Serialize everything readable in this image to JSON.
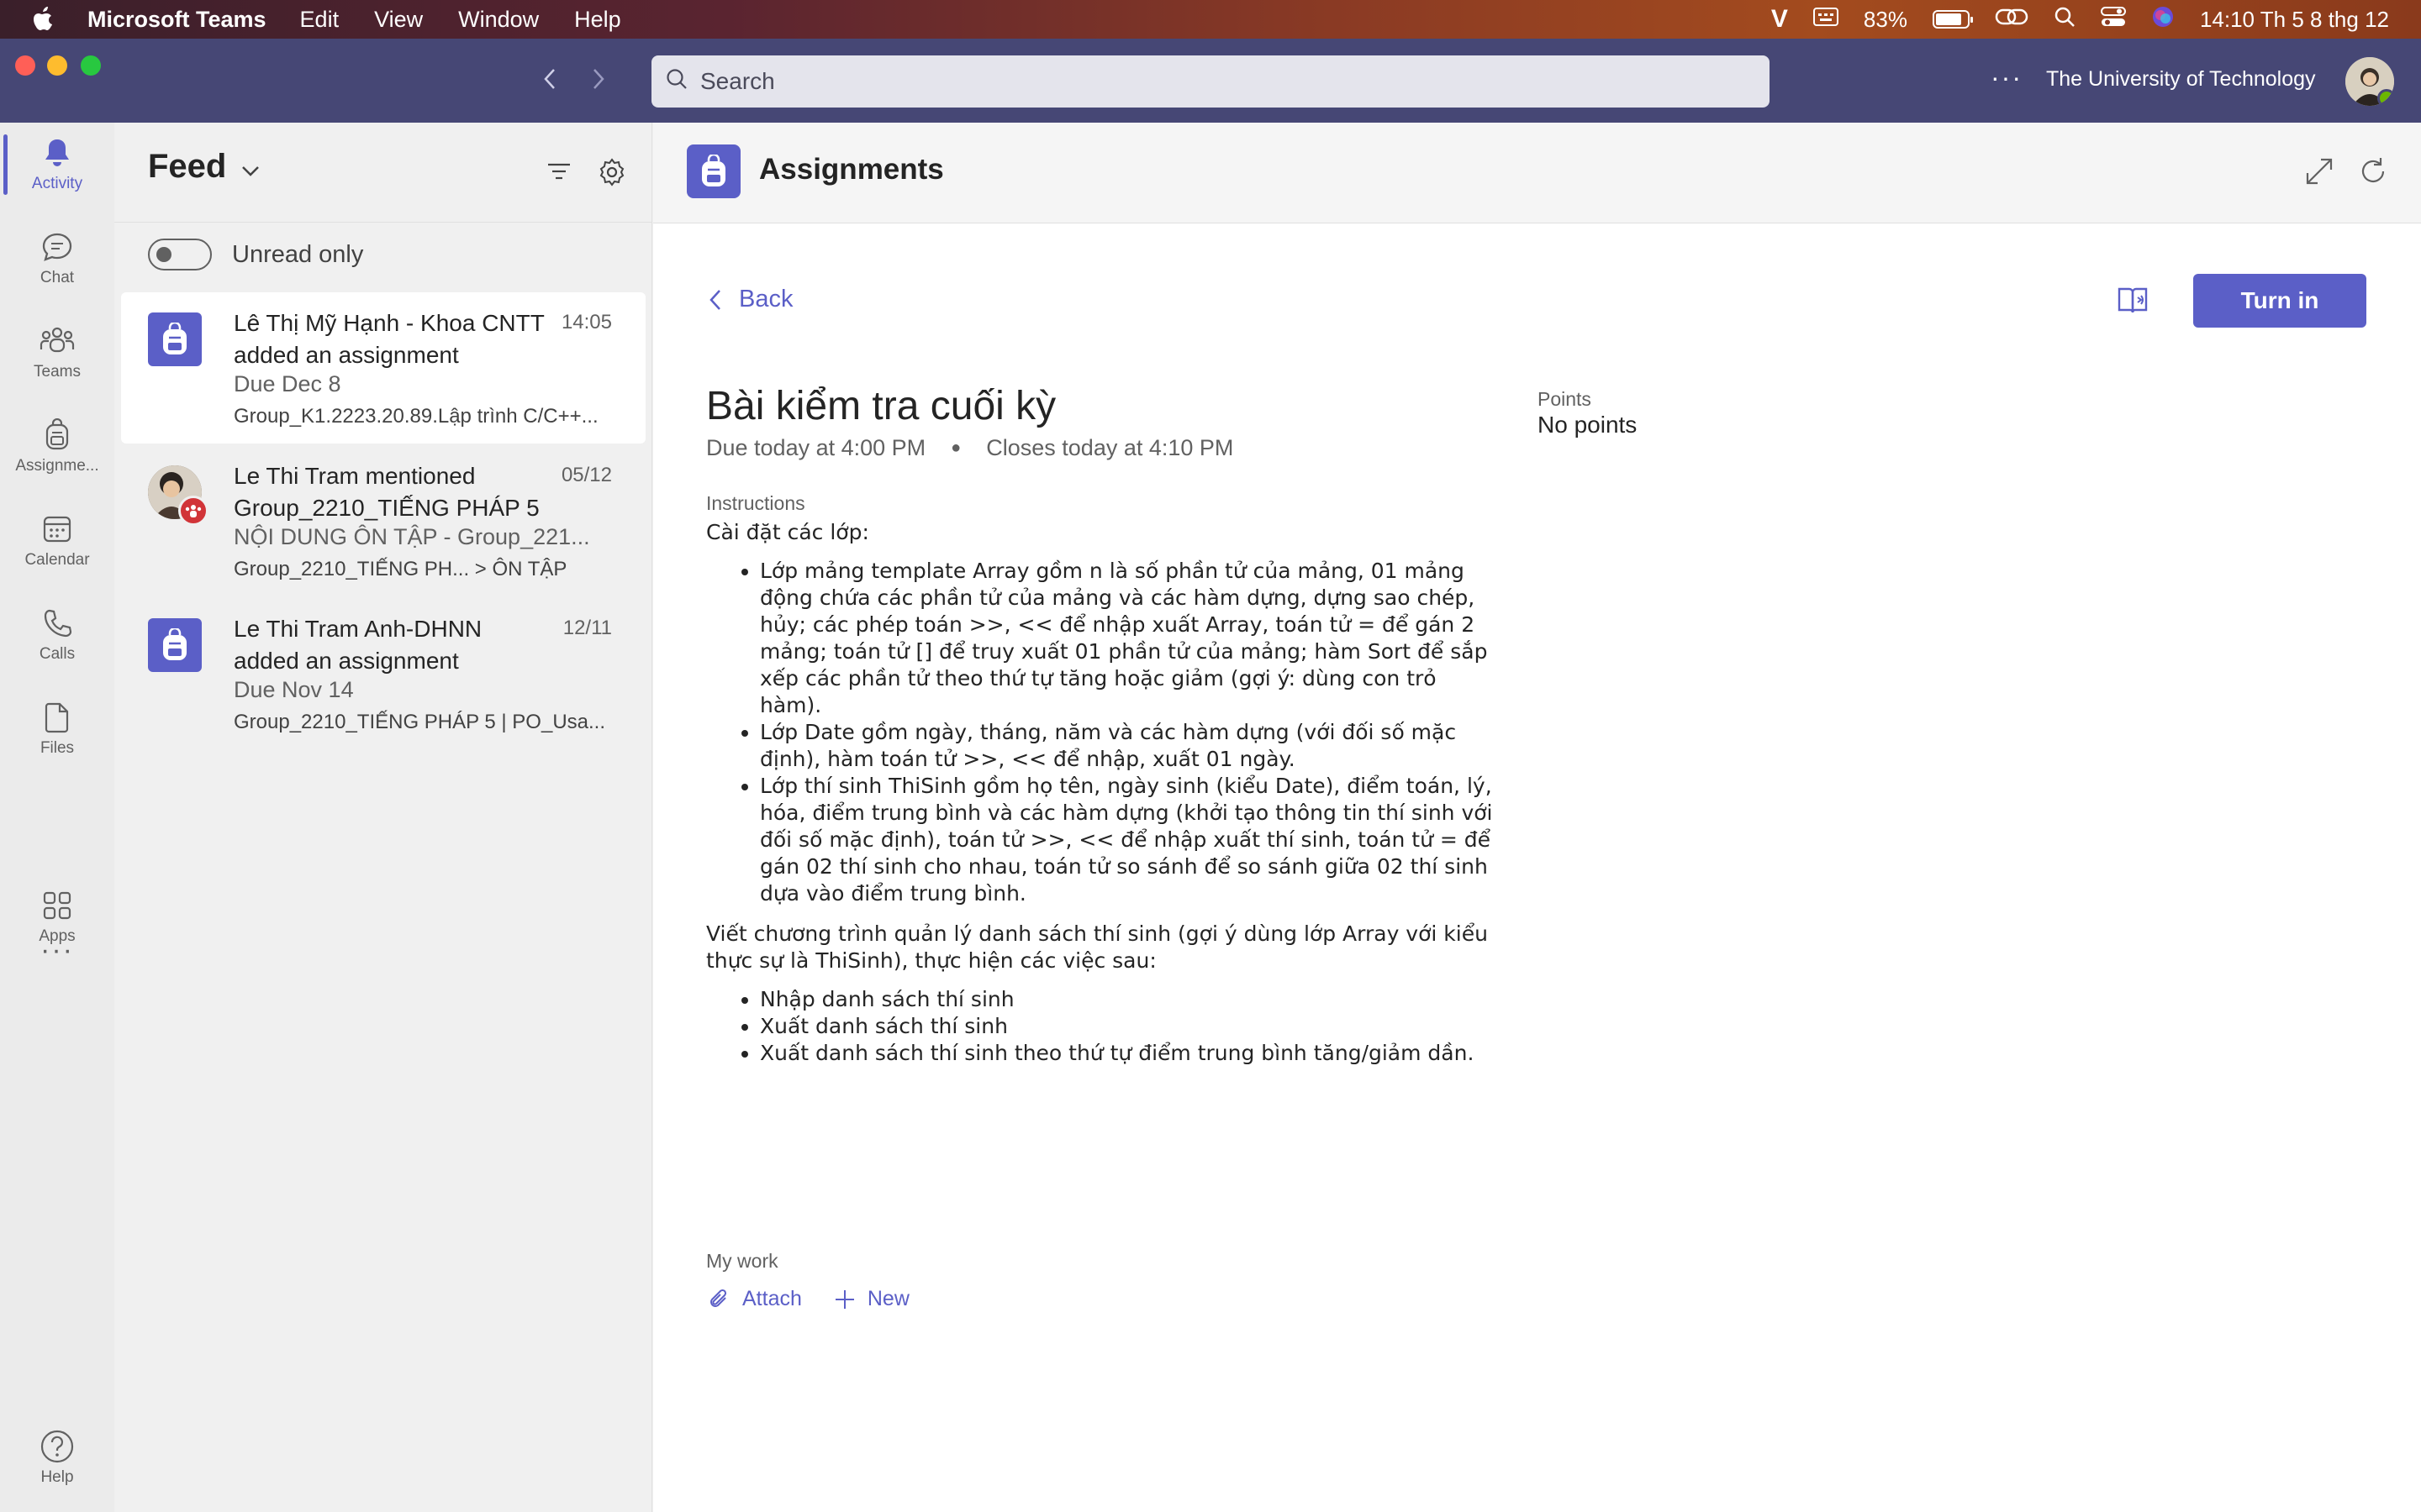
{
  "menubar": {
    "app_name": "Microsoft Teams",
    "menus": [
      "Edit",
      "View",
      "Window",
      "Help"
    ],
    "battery_percent": "83%",
    "battery_level": 0.83,
    "clock": "14:10 Th 5 8 thg 12"
  },
  "titlebar": {
    "search_placeholder": "Search",
    "more_label": "···",
    "org_name": "The University of Technology"
  },
  "rail": {
    "items": [
      {
        "label": "Activity",
        "icon": "bell-icon"
      },
      {
        "label": "Chat",
        "icon": "chat-icon"
      },
      {
        "label": "Teams",
        "icon": "teams-icon"
      },
      {
        "label": "Assignme...",
        "icon": "backpack-icon"
      },
      {
        "label": "Calendar",
        "icon": "calendar-icon"
      },
      {
        "label": "Calls",
        "icon": "phone-icon"
      },
      {
        "label": "Files",
        "icon": "file-icon"
      },
      {
        "label": "Apps",
        "icon": "apps-icon"
      }
    ],
    "more_label": "···",
    "help_label": "Help"
  },
  "feed": {
    "title": "Feed",
    "unread_only_label": "Unread only",
    "items": [
      {
        "line1": "Lê Thị Mỹ Hạnh - Khoa CNTT added an assignment",
        "time": "14:05",
        "line3": "Due Dec 8",
        "line4": "Group_K1.2223.20.89.Lập trình C/C++..."
      },
      {
        "line1": "Le Thi Tram mentioned Group_2210_TIẾNG PHÁP 5",
        "time": "05/12",
        "line3": "NỘI DUNG ÔN TẬP - Group_221...",
        "line4": "Group_2210_TIẾNG PH...   > ÔN TẬP"
      },
      {
        "line1": "Le Thi Tram Anh-DHNN added an assignment",
        "time": "12/11",
        "line3": "Due Nov 14",
        "line4": "Group_2210_TIẾNG PHÁP 5 | PO_Usa..."
      }
    ]
  },
  "main": {
    "title": "Assignments",
    "back_label": "Back",
    "turn_in_label": "Turn in",
    "assignment_title": "Bài kiểm tra cuối kỳ",
    "due": "Due today at 4:00 PM",
    "bullet": "●",
    "closes": "Closes today at 4:10 PM",
    "points_label": "Points",
    "points_value": "No points",
    "instructions_label": "Instructions",
    "instructions_intro": "Cài đặt các lớp:",
    "class_list": [
      "Lớp  mảng template Array gồm n là số phần tử của mảng, 01 mảng động chứa các phần tử của mảng và các hàm dựng, dựng sao chép, hủy; các phép toán >>, << để nhập xuất Array, toán tử = để gán 2 mảng; toán tử [] để truy xuất 01 phần tử của mảng; hàm Sort để sắp xếp các phần tử theo thứ tự tăng hoặc giảm (gợi ý: dùng con trỏ hàm).",
      "Lớp Date gồm ngày, tháng, năm và các hàm dựng (với đối số mặc định), hàm toán tử >>, << để nhập, xuất 01 ngày.",
      "Lớp thí sinh ThiSinh gồm họ tên, ngày sinh (kiểu Date), điểm toán, lý, hóa, điểm trung bình và các hàm dựng (khởi tạo thông tin thí sinh với đối số mặc định), toán tử >>, << để nhập xuất thí sinh, toán tử = để gán 02 thí sinh cho nhau, toán tử so sánh để so sánh giữa 02 thí sinh dựa vào điểm trung bình."
    ],
    "program_intro": "Viết chương trình quản lý danh sách thí sinh (gợi ý dùng lớp Array với kiểu thực sự là ThiSinh), thực hiện các việc sau:",
    "task_list": [
      "Nhập danh sách thí sinh",
      "Xuất danh sách thí sinh",
      "Xuất danh sách thí sinh theo thứ tự điểm trung bình tăng/giảm dần."
    ],
    "my_work_label": "My work",
    "attach_label": "Attach",
    "new_label": "New"
  },
  "colors": {
    "brand": "#5b5fc7",
    "titlebar": "#464775",
    "badge_red": "#d13438",
    "online_green": "#6bb700"
  }
}
